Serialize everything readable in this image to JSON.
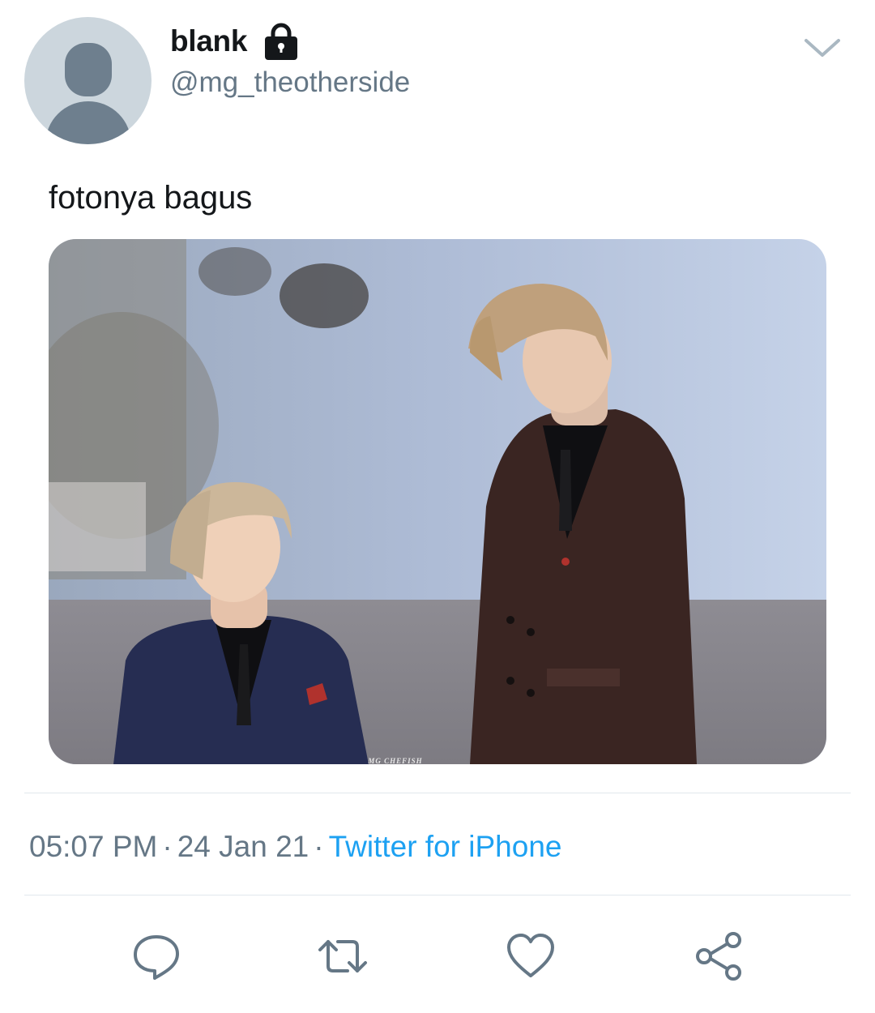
{
  "author": {
    "display_name": "blank",
    "handle": "@mg_theotherside",
    "avatar_icon": "default-avatar-icon",
    "protected_icon": "lock-icon"
  },
  "tweet": {
    "text": "fotonya bagus",
    "media_alt": "Photo of two men in suits on stage",
    "watermark": "MG CHEFISH"
  },
  "meta": {
    "time": "05:07 PM",
    "separator": "·",
    "date": "24 Jan 21",
    "source": "Twitter for iPhone"
  },
  "actions": [
    {
      "name": "reply",
      "icon": "reply-icon"
    },
    {
      "name": "retweet",
      "icon": "retweet-icon"
    },
    {
      "name": "like",
      "icon": "heart-icon"
    },
    {
      "name": "share",
      "icon": "share-icon"
    }
  ],
  "colors": {
    "handle_gray": "#657786",
    "link_blue": "#1da1f2",
    "divider": "#e1e8ed",
    "icon_gray": "#657786"
  }
}
